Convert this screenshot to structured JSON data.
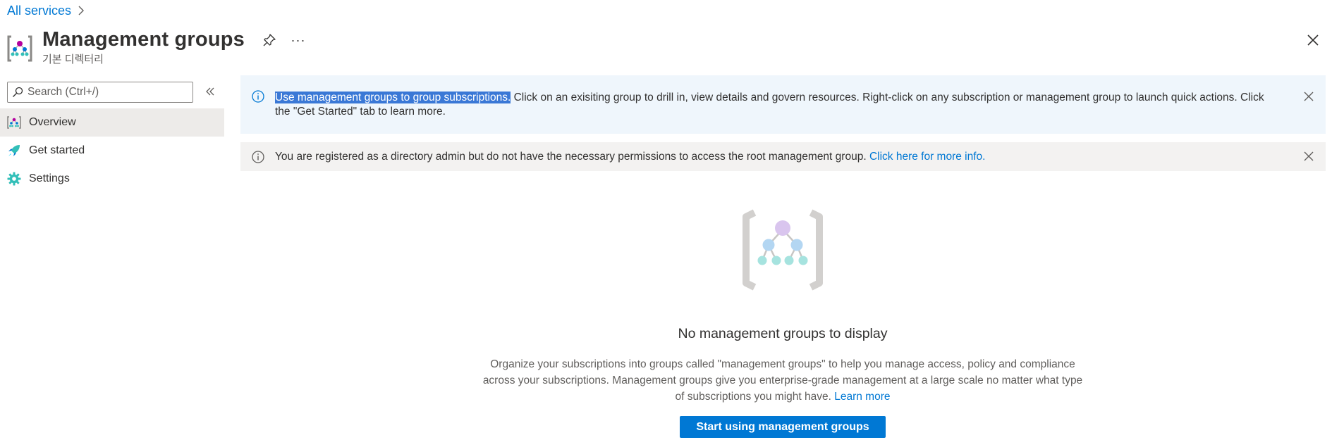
{
  "breadcrumb": {
    "link": "All services"
  },
  "header": {
    "title": "Management groups",
    "subtitle": "기본 디렉터리",
    "more": "···"
  },
  "sidebar": {
    "search": {
      "placeholder": "Search (Ctrl+/)",
      "value": ""
    },
    "items": [
      {
        "label": "Overview",
        "icon": "management-groups-icon",
        "active": true
      },
      {
        "label": "Get started",
        "icon": "rocket-icon",
        "active": false
      },
      {
        "label": "Settings",
        "icon": "gear-icon",
        "active": false
      }
    ]
  },
  "info_banner": {
    "highlighted": "Use management groups to group subscriptions.",
    "text": " Click on an exisiting group to drill in, view details and govern resources. Right-click on any subscription or management group to launch quick actions. Click the \"Get Started\" tab to learn more."
  },
  "warning_banner": {
    "text": "You are registered as a directory admin but do not have the necessary permissions to access the root management group. ",
    "link": "Click here for more info."
  },
  "empty_state": {
    "title": "No management groups to display",
    "description": "Organize your subscriptions into groups called \"management groups\" to help you manage access, policy and compliance across your subscriptions. Management groups give you enterprise-grade management at a large scale no matter what type of subscriptions you might have. ",
    "link": "Learn more",
    "button": "Start using management groups"
  },
  "colors": {
    "accent": "#0078d4",
    "info_bg": "#eff6fc",
    "warning_bg": "#f3f2f1",
    "highlight": "#3a78d6",
    "nav_active": "#edebe9"
  }
}
